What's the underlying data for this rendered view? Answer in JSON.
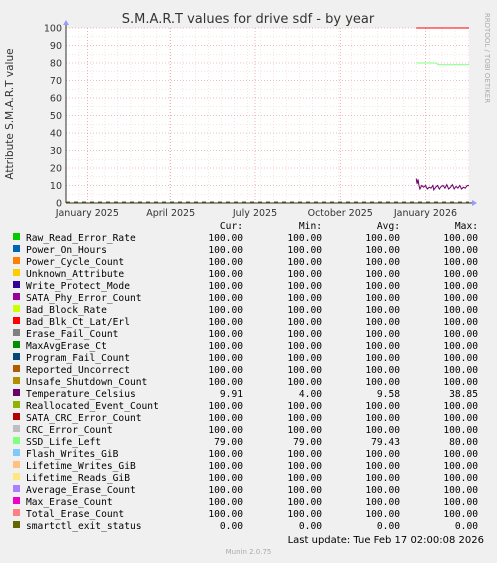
{
  "page": {
    "last_update": "Last update: Tue Feb 17 02:00:08 2026",
    "generator": "Munin 2.0.75",
    "watermark": "RRDTOOL / TOBI OETIKER"
  },
  "legend_headers": {
    "cur": "Cur:",
    "min": "Min:",
    "avg": "Avg:",
    "max": "Max:"
  },
  "legend": [
    {
      "name": "Raw_Read_Error_Rate",
      "color": "#00cc00",
      "cur": "100.00",
      "min": "100.00",
      "avg": "100.00",
      "max": "100.00"
    },
    {
      "name": "Power_On_Hours",
      "color": "#0066b3",
      "cur": "100.00",
      "min": "100.00",
      "avg": "100.00",
      "max": "100.00"
    },
    {
      "name": "Power_Cycle_Count",
      "color": "#ff8000",
      "cur": "100.00",
      "min": "100.00",
      "avg": "100.00",
      "max": "100.00"
    },
    {
      "name": "Unknown_Attribute",
      "color": "#ffcc00",
      "cur": "100.00",
      "min": "100.00",
      "avg": "100.00",
      "max": "100.00"
    },
    {
      "name": "Write_Protect_Mode",
      "color": "#330099",
      "cur": "100.00",
      "min": "100.00",
      "avg": "100.00",
      "max": "100.00"
    },
    {
      "name": "SATA_Phy_Error_Count",
      "color": "#990099",
      "cur": "100.00",
      "min": "100.00",
      "avg": "100.00",
      "max": "100.00"
    },
    {
      "name": "Bad_Block_Rate",
      "color": "#ccff00",
      "cur": "100.00",
      "min": "100.00",
      "avg": "100.00",
      "max": "100.00"
    },
    {
      "name": "Bad_Blk_Ct_Lat/Erl",
      "color": "#ff0000",
      "cur": "100.00",
      "min": "100.00",
      "avg": "100.00",
      "max": "100.00"
    },
    {
      "name": "Erase_Fail_Count",
      "color": "#808080",
      "cur": "100.00",
      "min": "100.00",
      "avg": "100.00",
      "max": "100.00"
    },
    {
      "name": "MaxAvgErase_Ct",
      "color": "#008f00",
      "cur": "100.00",
      "min": "100.00",
      "avg": "100.00",
      "max": "100.00"
    },
    {
      "name": "Program_Fail_Count",
      "color": "#00487d",
      "cur": "100.00",
      "min": "100.00",
      "avg": "100.00",
      "max": "100.00"
    },
    {
      "name": "Reported_Uncorrect",
      "color": "#b35a00",
      "cur": "100.00",
      "min": "100.00",
      "avg": "100.00",
      "max": "100.00"
    },
    {
      "name": "Unsafe_Shutdown_Count",
      "color": "#b38f00",
      "cur": "100.00",
      "min": "100.00",
      "avg": "100.00",
      "max": "100.00"
    },
    {
      "name": "Temperature_Celsius",
      "color": "#6b006b",
      "cur": "9.91",
      "min": "4.00",
      "avg": "9.58",
      "max": "38.85"
    },
    {
      "name": "Reallocated_Event_Count",
      "color": "#8fb300",
      "cur": "100.00",
      "min": "100.00",
      "avg": "100.00",
      "max": "100.00"
    },
    {
      "name": "SATA_CRC_Error_Count",
      "color": "#b30000",
      "cur": "100.00",
      "min": "100.00",
      "avg": "100.00",
      "max": "100.00"
    },
    {
      "name": "CRC_Error_Count",
      "color": "#bebebe",
      "cur": "100.00",
      "min": "100.00",
      "avg": "100.00",
      "max": "100.00"
    },
    {
      "name": "SSD_Life_Left",
      "color": "#80ff80",
      "cur": "79.00",
      "min": "79.00",
      "avg": "79.43",
      "max": "80.00"
    },
    {
      "name": "Flash_Writes_GiB",
      "color": "#80c9ff",
      "cur": "100.00",
      "min": "100.00",
      "avg": "100.00",
      "max": "100.00"
    },
    {
      "name": "Lifetime_Writes_GiB",
      "color": "#ffc080",
      "cur": "100.00",
      "min": "100.00",
      "avg": "100.00",
      "max": "100.00"
    },
    {
      "name": "Lifetime_Reads_GiB",
      "color": "#ffe680",
      "cur": "100.00",
      "min": "100.00",
      "avg": "100.00",
      "max": "100.00"
    },
    {
      "name": "Average_Erase_Count",
      "color": "#aa80ff",
      "cur": "100.00",
      "min": "100.00",
      "avg": "100.00",
      "max": "100.00"
    },
    {
      "name": "Max_Erase_Count",
      "color": "#ee00cc",
      "cur": "100.00",
      "min": "100.00",
      "avg": "100.00",
      "max": "100.00"
    },
    {
      "name": "Total_Erase_Count",
      "color": "#ff8080",
      "cur": "100.00",
      "min": "100.00",
      "avg": "100.00",
      "max": "100.00"
    },
    {
      "name": "smartctl_exit_status",
      "color": "#666600",
      "cur": "0.00",
      "min": "0.00",
      "avg": "0.00",
      "max": "0.00"
    }
  ],
  "chart_data": {
    "type": "line",
    "title": "S.M.A.R.T values for drive sdf - by year",
    "ylabel": "Attribute S.M.A.R.T value",
    "xlabel": "",
    "ylim": [
      0,
      100
    ],
    "xlim": [
      "2024-12-09",
      "2026-02-17"
    ],
    "yticks": [
      0,
      10,
      20,
      30,
      40,
      50,
      60,
      70,
      80,
      90,
      100
    ],
    "xticks": [
      {
        "label": "January 2025",
        "date": "2025-01-01"
      },
      {
        "label": "April 2025",
        "date": "2025-04-01"
      },
      {
        "label": "July 2025",
        "date": "2025-07-01"
      },
      {
        "label": "October 2025",
        "date": "2025-10-01"
      },
      {
        "label": "January 2026",
        "date": "2026-01-01"
      }
    ],
    "grid": true,
    "series": [
      {
        "name": "Bad_Blk_Ct_Lat/Erl",
        "color": "#ff0000",
        "points": [
          [
            "2025-12-22",
            100
          ],
          [
            "2026-02-17",
            100
          ]
        ]
      },
      {
        "name": "SSD_Life_Left",
        "color": "#80ff80",
        "points": [
          [
            "2025-12-22",
            80
          ],
          [
            "2026-01-12",
            80
          ],
          [
            "2026-01-15",
            79
          ],
          [
            "2026-02-17",
            79
          ]
        ]
      },
      {
        "name": "Temperature_Celsius",
        "color": "#6b006b",
        "points": [
          [
            "2025-12-22",
            14
          ],
          [
            "2025-12-23",
            11
          ],
          [
            "2025-12-24",
            13.5
          ],
          [
            "2025-12-25",
            10
          ],
          [
            "2025-12-26",
            8
          ],
          [
            "2025-12-28",
            10
          ],
          [
            "2025-12-30",
            9
          ],
          [
            "2026-01-01",
            10
          ],
          [
            "2026-01-03",
            8
          ],
          [
            "2026-01-05",
            9
          ],
          [
            "2026-01-07",
            8.5
          ],
          [
            "2026-01-09",
            10
          ],
          [
            "2026-01-10",
            7.5
          ],
          [
            "2026-01-12",
            9
          ],
          [
            "2026-01-14",
            10
          ],
          [
            "2026-01-16",
            8
          ],
          [
            "2026-01-18",
            9.5
          ],
          [
            "2026-01-20",
            10
          ],
          [
            "2026-01-22",
            8.5
          ],
          [
            "2026-01-24",
            10.5
          ],
          [
            "2026-01-26",
            8
          ],
          [
            "2026-01-28",
            9
          ],
          [
            "2026-01-30",
            10.5
          ],
          [
            "2026-02-01",
            8
          ],
          [
            "2026-02-03",
            9.5
          ],
          [
            "2026-02-05",
            8.5
          ],
          [
            "2026-02-07",
            10
          ],
          [
            "2026-02-09",
            8
          ],
          [
            "2026-02-11",
            9
          ],
          [
            "2026-02-13",
            8.5
          ],
          [
            "2026-02-15",
            10
          ],
          [
            "2026-02-17",
            9.91
          ]
        ]
      }
    ]
  }
}
